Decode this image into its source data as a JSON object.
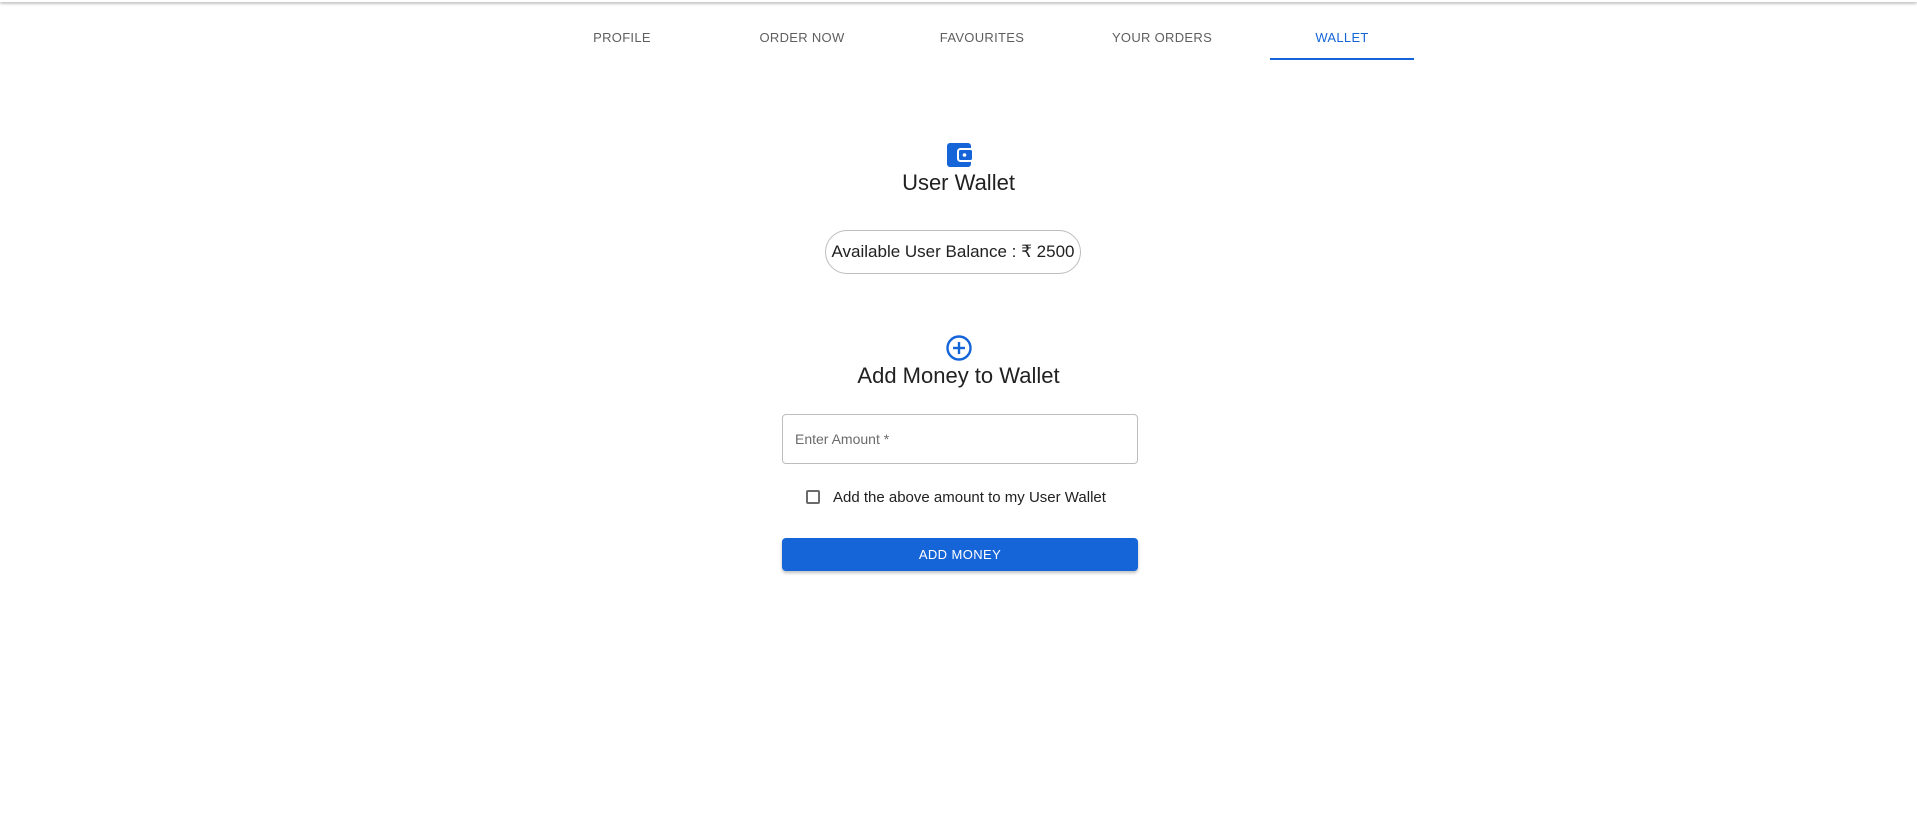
{
  "tabs": [
    {
      "label": "PROFILE"
    },
    {
      "label": "ORDER NOW"
    },
    {
      "label": "FAVOURITES"
    },
    {
      "label": "YOUR ORDERS"
    },
    {
      "label": "WALLET",
      "active": true
    }
  ],
  "wallet": {
    "icon": "wallet-icon",
    "title": "User Wallet",
    "balance_text": "Available User Balance : ₹ 2500"
  },
  "add_money": {
    "icon": "add-circle-icon",
    "title": "Add Money to Wallet",
    "amount_placeholder": "Enter Amount *",
    "amount_value": "",
    "checkbox_label": "Add the above amount to my User Wallet",
    "checkbox_checked": false,
    "button_label": "ADD MONEY"
  },
  "colors": {
    "accent": "#1565d8",
    "text": "#212121",
    "muted": "#5f5f5f",
    "border": "#bdbdbd"
  }
}
